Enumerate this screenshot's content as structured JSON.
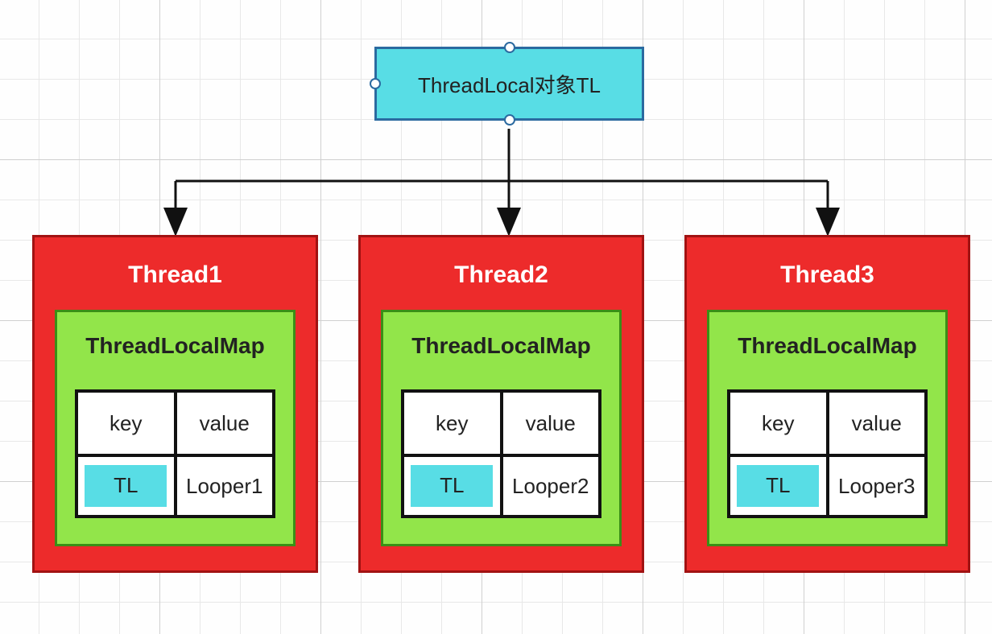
{
  "top_node": {
    "label": "ThreadLocal对象TL"
  },
  "threads": [
    {
      "title": "Thread1",
      "map_title": "ThreadLocalMap",
      "key_header": "key",
      "value_header": "value",
      "key": "TL",
      "value": "Looper1"
    },
    {
      "title": "Thread2",
      "map_title": "ThreadLocalMap",
      "key_header": "key",
      "value_header": "value",
      "key": "TL",
      "value": "Looper2"
    },
    {
      "title": "Thread3",
      "map_title": "ThreadLocalMap",
      "key_header": "key",
      "value_header": "value",
      "key": "TL",
      "value": "Looper3"
    }
  ],
  "colors": {
    "top_node_fill": "#58dde5",
    "thread_fill": "#ed2b2b",
    "map_fill": "#92e54a",
    "tl_chip_fill": "#58dde5"
  }
}
